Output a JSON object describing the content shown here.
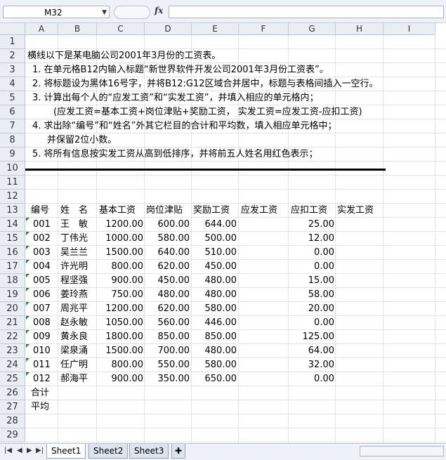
{
  "name_box": {
    "value": "M32"
  },
  "formula": {
    "fx_label": "fx",
    "value": ""
  },
  "columns": [
    "A",
    "B",
    "C",
    "D",
    "E",
    "F",
    "G",
    "H",
    "I"
  ],
  "rows": [
    "1",
    "2",
    "3",
    "4",
    "5",
    "6",
    "7",
    "8",
    "9",
    "10",
    "11",
    "12",
    "13",
    "14",
    "15",
    "16",
    "17",
    "18",
    "19",
    "20",
    "21",
    "22",
    "23",
    "24",
    "25",
    "26",
    "27",
    "28",
    "29"
  ],
  "instructions": {
    "line2": "横线以下是某电脑公司2001年3月份的工资表。",
    "line3": "1. 在单元格B12内输入标题“新世界软件开发公司2001年3月份工资表”。",
    "line4": "2. 将标题设为黑体16号字，并将B12:G12区域合并居中，标题与表格间插入一空行。",
    "line5": "3. 计算出每个人的“应发工资”和“实发工资”，并填入相应的单元格内；",
    "line6": "(应发工资=基本工资+岗位津贴+奖励工资， 实发工资=应发工资-应扣工资)",
    "line7": "4. 求出除“编号”和“姓名”外其它栏目的合计和平均数，填入相应单元格中；",
    "line8": "并保留2位小数。",
    "line9": "5. 将所有信息按实发工资从高到低排序，并将前五人姓名用红色表示；"
  },
  "table": {
    "headers": [
      "编号",
      "姓　名",
      "基本工资",
      "岗位津贴",
      "奖励工资",
      "应发工资",
      "应扣工资",
      "实发工资"
    ],
    "rows": [
      {
        "id": "001",
        "name": "王　敏",
        "base": "1200.00",
        "allow": "600.00",
        "bonus": "644.00",
        "deduct": "25.00"
      },
      {
        "id": "002",
        "name": "丁伟光",
        "base": "1000.00",
        "allow": "580.00",
        "bonus": "500.00",
        "deduct": "12.00"
      },
      {
        "id": "003",
        "name": "吴兰兰",
        "base": "1500.00",
        "allow": "640.00",
        "bonus": "510.00",
        "deduct": "0.00"
      },
      {
        "id": "004",
        "name": "许光明",
        "base": "800.00",
        "allow": "620.00",
        "bonus": "450.00",
        "deduct": "0.00"
      },
      {
        "id": "005",
        "name": "程坚强",
        "base": "900.00",
        "allow": "450.00",
        "bonus": "480.00",
        "deduct": "15.00"
      },
      {
        "id": "006",
        "name": "姜玲燕",
        "base": "750.00",
        "allow": "480.00",
        "bonus": "480.00",
        "deduct": "58.00"
      },
      {
        "id": "007",
        "name": "周兆平",
        "base": "1200.00",
        "allow": "620.00",
        "bonus": "580.00",
        "deduct": "20.00"
      },
      {
        "id": "008",
        "name": "赵永敏",
        "base": "1050.00",
        "allow": "560.00",
        "bonus": "446.00",
        "deduct": "0.00"
      },
      {
        "id": "009",
        "name": "黄永良",
        "base": "1800.00",
        "allow": "850.00",
        "bonus": "850.00",
        "deduct": "125.00"
      },
      {
        "id": "010",
        "name": "梁泉涌",
        "base": "1500.00",
        "allow": "700.00",
        "bonus": "480.00",
        "deduct": "64.00"
      },
      {
        "id": "011",
        "name": "任广明",
        "base": "800.00",
        "allow": "550.00",
        "bonus": "580.00",
        "deduct": "32.00"
      },
      {
        "id": "012",
        "name": "郝海平",
        "base": "900.00",
        "allow": "350.00",
        "bonus": "650.00",
        "deduct": "0.00"
      }
    ],
    "total_label": "合计",
    "avg_label": "平均"
  },
  "sheets": [
    "Sheet1",
    "Sheet2",
    "Sheet3"
  ],
  "nav_icons": [
    "first-sheet-icon",
    "prev-sheet-icon",
    "next-sheet-icon",
    "last-sheet-icon"
  ],
  "colors": {
    "header_bg": "#e9eef5",
    "grid_line": "#dde2e8",
    "error_triangle": "#1e8c1e"
  }
}
